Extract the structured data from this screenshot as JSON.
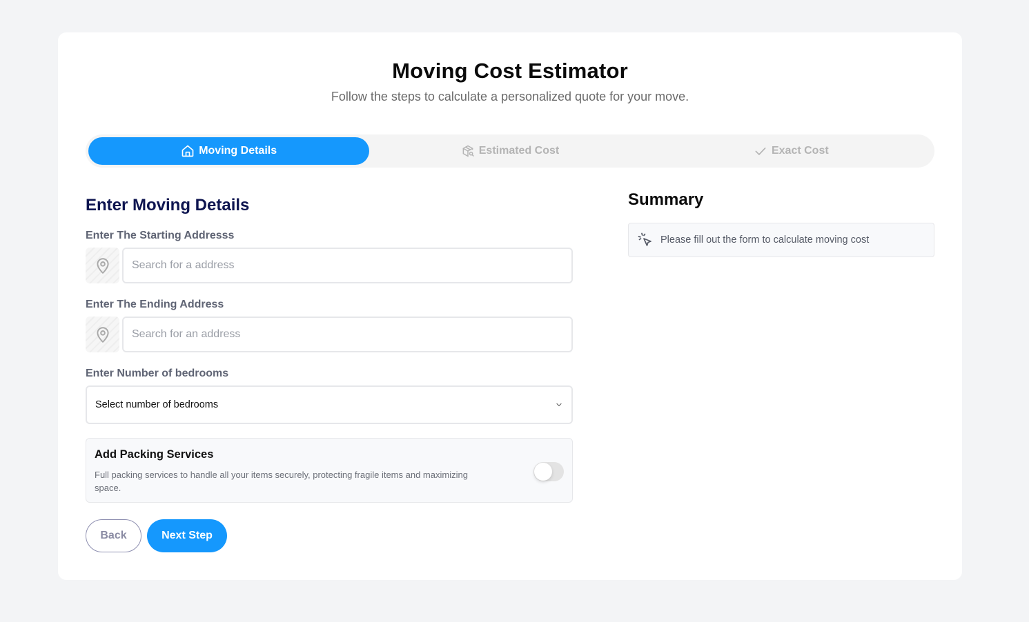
{
  "header": {
    "title": "Moving Cost Estimator",
    "subtitle": "Follow the steps to calculate a personalized quote for your move."
  },
  "stepper": {
    "steps": [
      {
        "label": "Moving Details",
        "icon": "home-icon",
        "active": true
      },
      {
        "label": "Estimated Cost",
        "icon": "package-search-icon",
        "active": false
      },
      {
        "label": "Exact Cost",
        "icon": "check-icon",
        "active": false
      }
    ]
  },
  "form": {
    "section_title": "Enter Moving Details",
    "start_address": {
      "label": "Enter The Starting Addresss",
      "placeholder": "Search for a address",
      "value": "",
      "icon": "map-pin-icon"
    },
    "end_address": {
      "label": "Enter The Ending Address",
      "placeholder": "Search for an address",
      "value": "",
      "icon": "map-pin-icon"
    },
    "bedrooms": {
      "label": "Enter Number of bedrooms",
      "selected": "Select number of bedrooms",
      "icon": "chevron-down-icon"
    },
    "packing": {
      "title": "Add Packing Services",
      "description": "Full packing services to handle all your items securely, protecting fragile items and maximizing space.",
      "enabled": false
    },
    "buttons": {
      "back": "Back",
      "next": "Next Step"
    }
  },
  "summary": {
    "title": "Summary",
    "message": "Please fill out the form to calculate moving cost",
    "icon": "pointer-click-icon"
  },
  "colors": {
    "accent": "#1598fd",
    "heading": "#0e1550",
    "background": "#f3f4f6"
  }
}
